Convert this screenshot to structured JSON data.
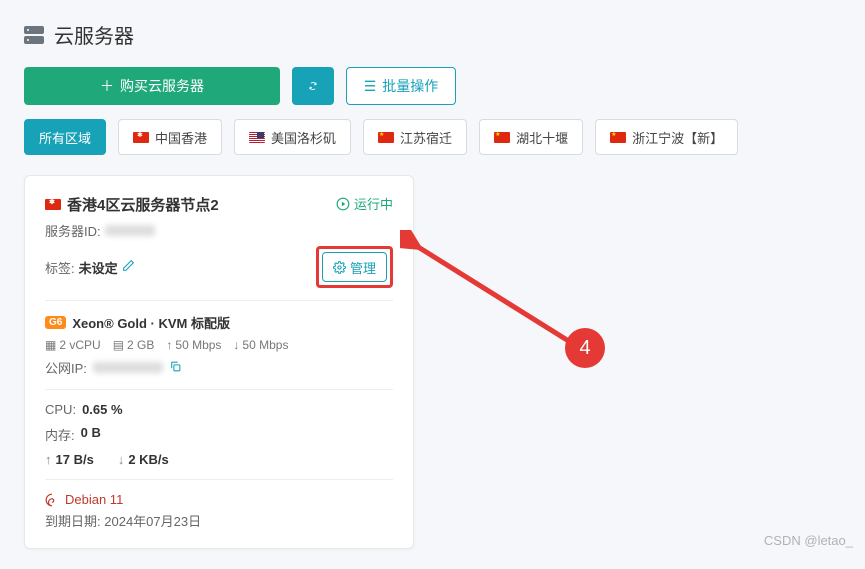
{
  "header": {
    "title": "云服务器"
  },
  "toolbar": {
    "buy_label": "购买云服务器",
    "batch_label": "批量操作"
  },
  "regions": [
    {
      "label": "所有区域",
      "active": true,
      "flag": null
    },
    {
      "label": "中国香港",
      "active": false,
      "flag": "hk"
    },
    {
      "label": "美国洛杉矶",
      "active": false,
      "flag": "us"
    },
    {
      "label": "江苏宿迁",
      "active": false,
      "flag": "cn"
    },
    {
      "label": "湖北十堰",
      "active": false,
      "flag": "cn"
    },
    {
      "label": "浙江宁波【新】",
      "active": false,
      "flag": "cn"
    }
  ],
  "card": {
    "title": "香港4区云服务器节点2",
    "status_label": "运行中",
    "server_id_label": "服务器ID:",
    "tag_label": "标签:",
    "tag_value": "未设定",
    "manage_label": "管理",
    "spec_badge": "G6",
    "spec_name": "Xeon® Gold · KVM 标配版",
    "vcpu": "2 vCPU",
    "ram": "2 GB",
    "bw_up": "50 Mbps",
    "bw_down": "50 Mbps",
    "ip_label": "公网IP:",
    "cpu_label": "CPU:",
    "cpu_value": "0.65 %",
    "mem_label": "内存:",
    "mem_value": "0 B",
    "net_up": "17 B/s",
    "net_down": "2 KB/s",
    "os_name": "Debian 11",
    "expiry_label": "到期日期:",
    "expiry_value": "2024年07月23日"
  },
  "annotation": {
    "number": "4"
  },
  "watermark": "CSDN @letao_"
}
